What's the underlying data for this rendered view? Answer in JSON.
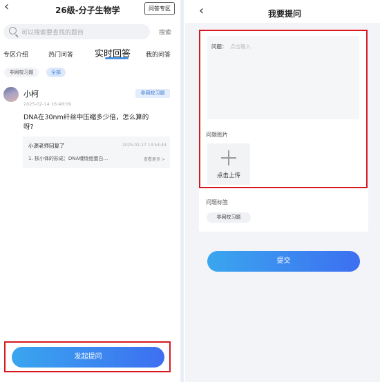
{
  "left": {
    "header": {
      "title": "26级-分子生物学",
      "qa_zone_label": "问答专区"
    },
    "search": {
      "placeholder": "可以搜索要查找的题目",
      "button_label": "搜索"
    },
    "tabs": [
      {
        "label": "专区介绍"
      },
      {
        "label": "热门问答"
      },
      {
        "label": "实时回答",
        "active": true
      },
      {
        "label": "我的问答"
      }
    ],
    "filters": [
      "非网校习题",
      "全部"
    ],
    "post": {
      "user_name": "小柯",
      "time": "2025-02-14 16:48:09",
      "tag": "非网校习题",
      "question": "DNA在30nm纤丝中压缩多少倍，怎么算的呀?",
      "reply": {
        "author": "小源老师回复了",
        "time": "2025-02-17 13:54:44",
        "snippet": "1. 核小体的形成：DNA缠绕组蛋白…",
        "more": "查看更多 >"
      }
    },
    "ask_button_label": "发起提问"
  },
  "right": {
    "header": {
      "title": "我要提问"
    },
    "form": {
      "question_label": "问题：",
      "question_placeholder": "点击输入",
      "images_label": "问题图片",
      "upload_label": "点击上传",
      "tags_label": "问题标签",
      "tag": "非网校习题"
    },
    "submit_label": "提交"
  },
  "colors": {
    "accent": "#3d7ad6",
    "button_gradient_start": "#3aa6ef",
    "button_gradient_end": "#3d6ff0",
    "highlight_frame": "#d7191f"
  }
}
